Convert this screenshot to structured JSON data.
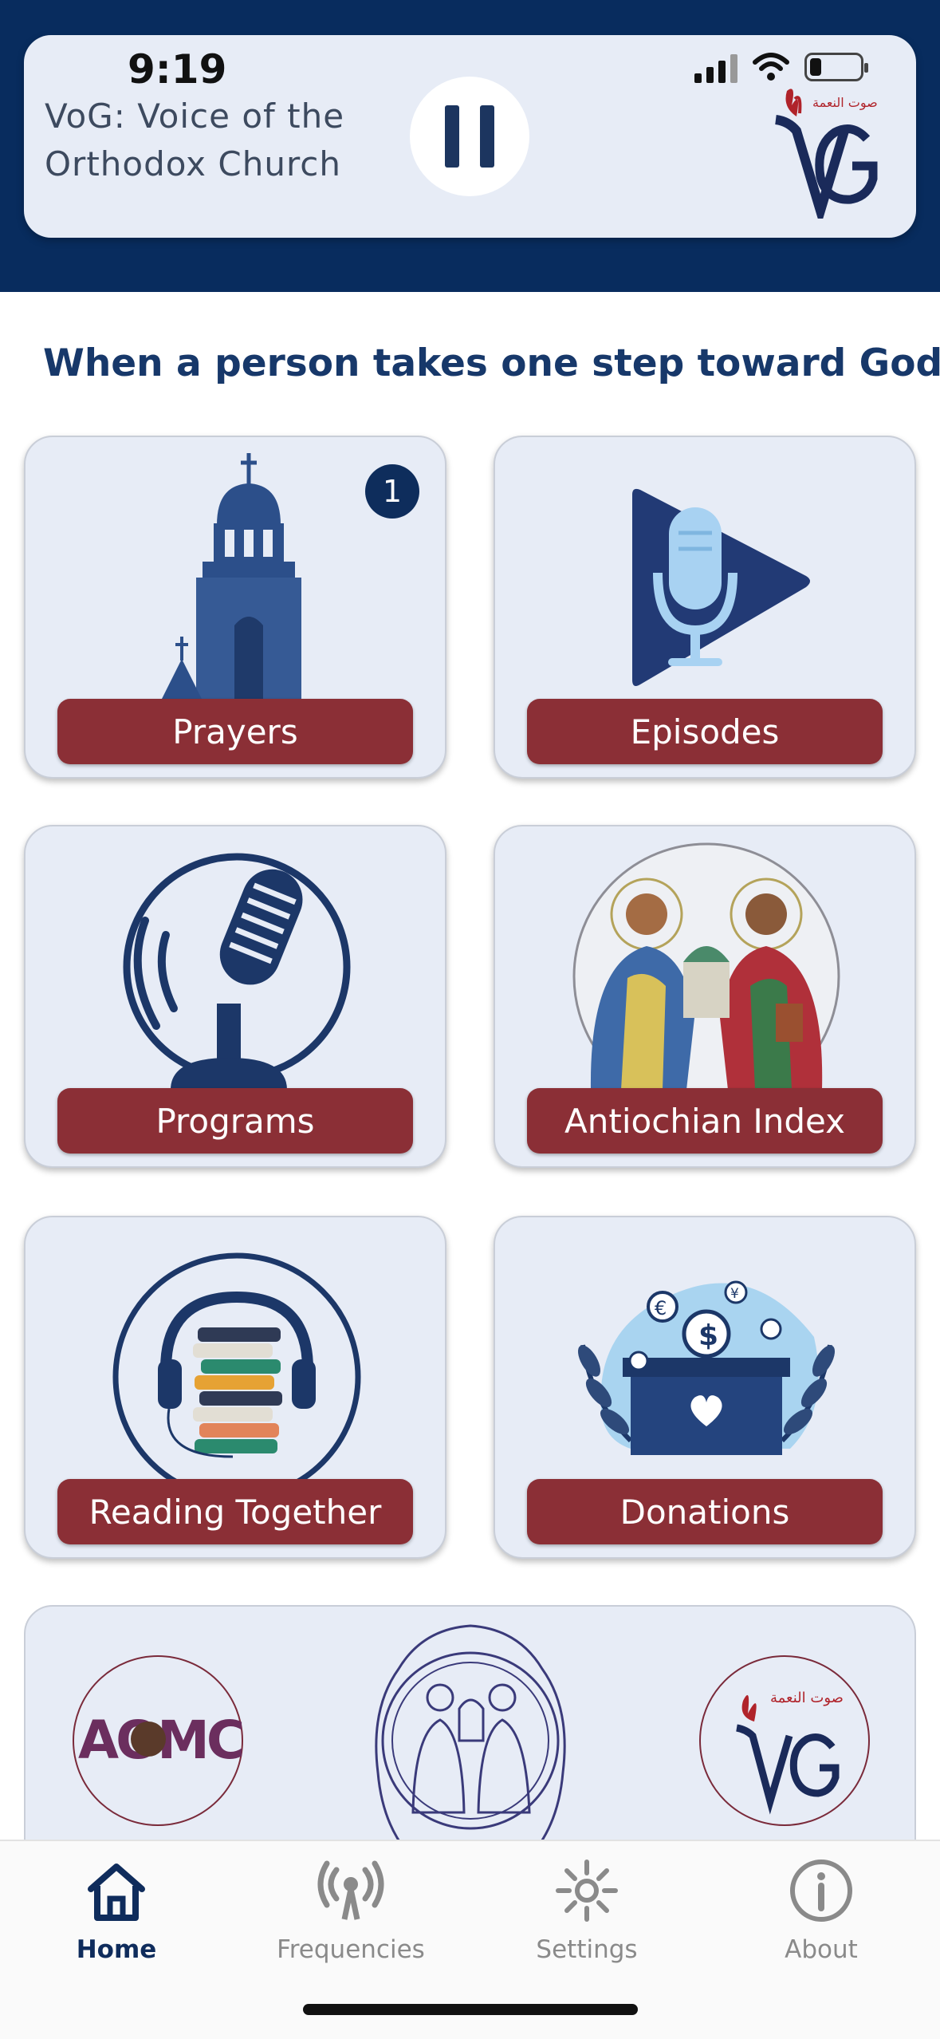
{
  "status_bar": {
    "time": "9:19"
  },
  "player": {
    "title": "VoG: Voice of the Orthodox Church",
    "logo_arabic": "صوت النعمة",
    "pause_icon": "pause-icon"
  },
  "marquee": {
    "text": "When a person takes one step toward God, God ta"
  },
  "tiles": [
    {
      "label": "Prayers",
      "icon": "church-tower-icon",
      "badge": "1"
    },
    {
      "label": "Episodes",
      "icon": "microphone-play-icon"
    },
    {
      "label": "Programs",
      "icon": "podcast-microphone-icon"
    },
    {
      "label": "Antiochian Index",
      "icon": "saints-icon"
    },
    {
      "label": "Reading Together",
      "icon": "headphones-books-icon"
    },
    {
      "label": "Donations",
      "icon": "donation-box-icon"
    }
  ],
  "partners": [
    {
      "name": "AOMC",
      "icon": "aomc-logo"
    },
    {
      "name": "Patriarchate seal",
      "icon": "saints-seal-logo"
    },
    {
      "name": "VoG",
      "icon": "vog-logo",
      "arabic": "صوت النعمة"
    }
  ],
  "tabbar": {
    "items": [
      {
        "label": "Home",
        "icon": "home-icon",
        "active": true
      },
      {
        "label": "Frequencies",
        "icon": "broadcast-icon",
        "active": false
      },
      {
        "label": "Settings",
        "icon": "gear-icon",
        "active": false
      },
      {
        "label": "About",
        "icon": "info-icon",
        "active": false
      }
    ]
  },
  "colors": {
    "header": "#082c5e",
    "card": "#e7ecf6",
    "button": "#8b2f36",
    "accent_dark": "#1c355f",
    "tab_active": "#0f2c5c",
    "tab_inactive": "#8a8a8a"
  }
}
